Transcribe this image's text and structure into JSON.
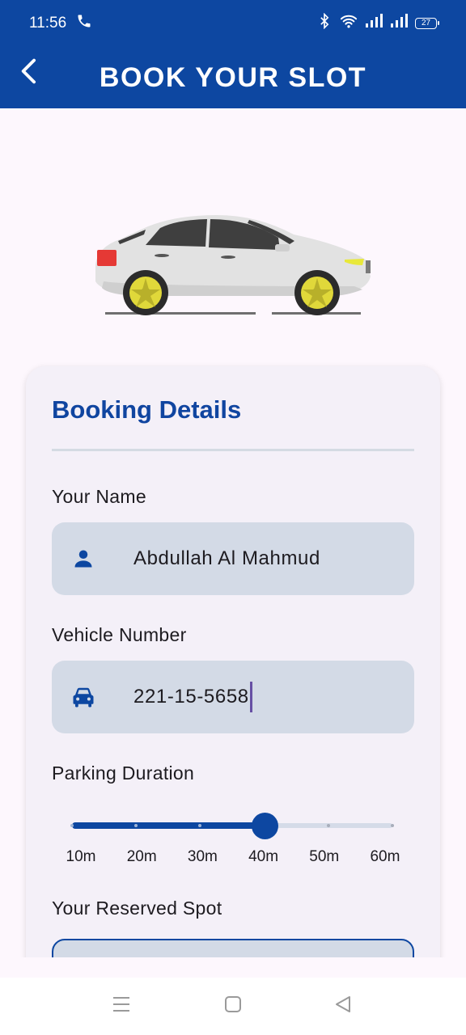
{
  "status_bar": {
    "time": "11:56",
    "battery": "27",
    "icons": [
      "phone-icon",
      "bluetooth-icon",
      "wifi-icon",
      "signal-icon",
      "signal-icon",
      "battery-icon"
    ]
  },
  "app_bar": {
    "title": "BOOK YOUR SLOT",
    "back_icon": "chevron-left-icon"
  },
  "colors": {
    "primary": "#0d47a1",
    "card_bg": "#f4f0f8",
    "input_bg": "#d3dae6",
    "page_bg": "#fdf7fd"
  },
  "booking": {
    "title": "Booking Details",
    "name_label": "Your Name",
    "name_value": "Abdullah Al Mahmud",
    "name_icon": "person-icon",
    "vehicle_label": "Vehicle Number",
    "vehicle_value": "221-15-5658",
    "vehicle_icon": "car-icon",
    "duration_label": "Parking Duration",
    "duration_options": [
      "10m",
      "20m",
      "30m",
      "40m",
      "50m",
      "60m"
    ],
    "duration_selected_index": 3,
    "spot_label": "Your Reserved Spot"
  },
  "nav_bar": {
    "icons": [
      "menu-icon",
      "home-square-icon",
      "back-triangle-icon"
    ]
  }
}
